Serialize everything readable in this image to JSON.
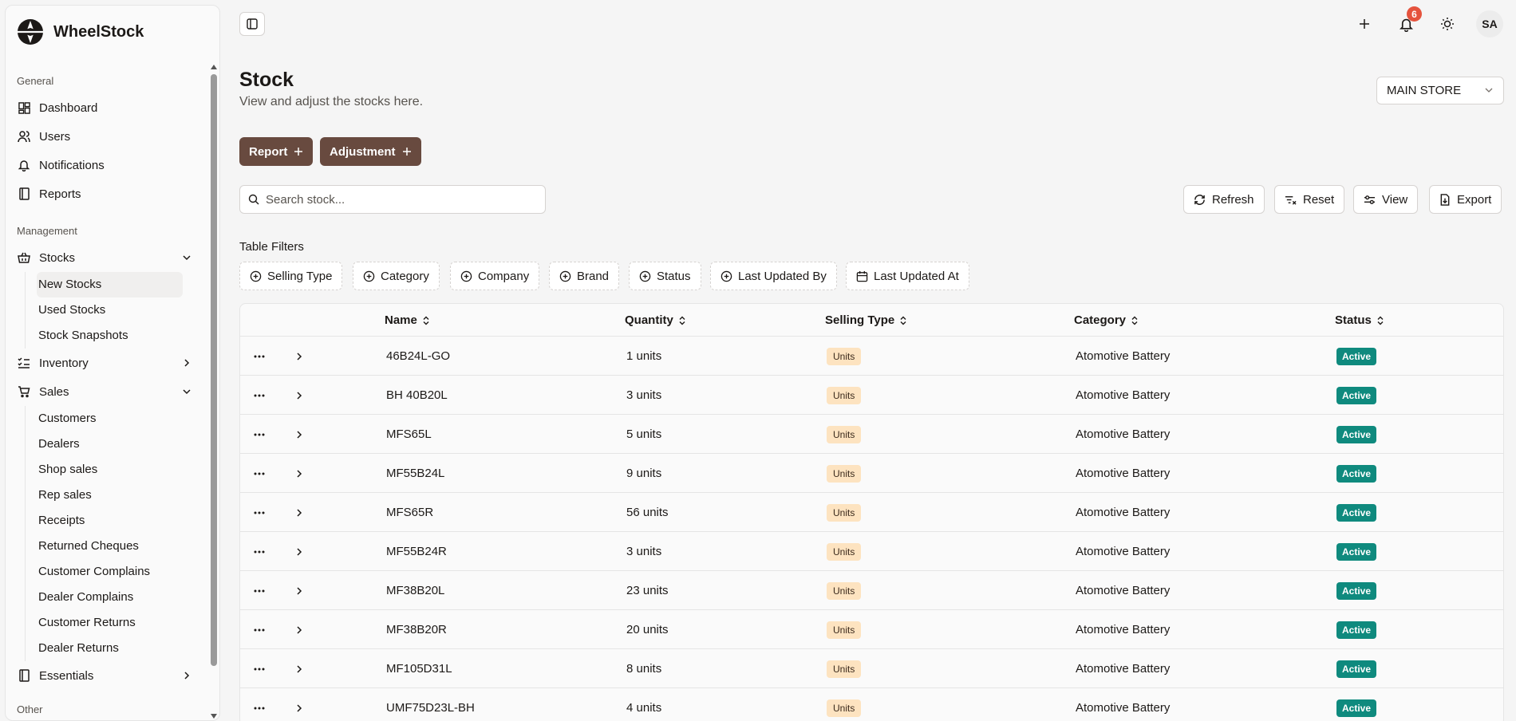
{
  "app": {
    "name": "WheelStock"
  },
  "sidebar": {
    "sections": [
      {
        "label": "General"
      },
      {
        "label": "Management"
      },
      {
        "label": "Other"
      }
    ],
    "general": [
      {
        "label": "Dashboard",
        "icon": "dashboard-icon"
      },
      {
        "label": "Users",
        "icon": "users-icon"
      },
      {
        "label": "Notifications",
        "icon": "bell-icon"
      },
      {
        "label": "Reports",
        "icon": "book-icon"
      }
    ],
    "stocks": {
      "label": "Stocks",
      "expanded": true,
      "children": [
        "New Stocks",
        "Used Stocks",
        "Stock Snapshots"
      ],
      "active_child": "New Stocks"
    },
    "inventory": {
      "label": "Inventory",
      "expanded": false
    },
    "sales": {
      "label": "Sales",
      "expanded": true,
      "children": [
        "Customers",
        "Dealers",
        "Shop sales",
        "Rep sales",
        "Receipts",
        "Returned Cheques",
        "Customer Complains",
        "Dealer Complains",
        "Customer Returns",
        "Dealer Returns"
      ]
    },
    "essentials": {
      "label": "Essentials",
      "expanded": false
    }
  },
  "topbar": {
    "notification_count": "6",
    "avatar": "SA"
  },
  "page": {
    "title": "Stock",
    "subtitle": "View and adjust the stocks here.",
    "store": "MAIN STORE"
  },
  "actions": {
    "report": "Report",
    "adjustment": "Adjustment"
  },
  "search": {
    "placeholder": "Search stock..."
  },
  "toolbar": {
    "refresh": "Refresh",
    "reset": "Reset",
    "view": "View",
    "export": "Export"
  },
  "filters": {
    "label": "Table Filters",
    "chips": [
      "Selling Type",
      "Category",
      "Company",
      "Brand",
      "Status",
      "Last Updated By",
      "Last Updated At"
    ]
  },
  "table": {
    "columns": [
      "Name",
      "Quantity",
      "Selling Type",
      "Category",
      "Status"
    ],
    "rows": [
      {
        "name": "46B24L-GO",
        "quantity": "1 units",
        "selling_type": "Units",
        "category": "Atomotive Battery",
        "status": "Active"
      },
      {
        "name": "BH 40B20L",
        "quantity": "3 units",
        "selling_type": "Units",
        "category": "Atomotive Battery",
        "status": "Active"
      },
      {
        "name": "MFS65L",
        "quantity": "5 units",
        "selling_type": "Units",
        "category": "Atomotive Battery",
        "status": "Active"
      },
      {
        "name": "MF55B24L",
        "quantity": "9 units",
        "selling_type": "Units",
        "category": "Atomotive Battery",
        "status": "Active"
      },
      {
        "name": "MFS65R",
        "quantity": "56 units",
        "selling_type": "Units",
        "category": "Atomotive Battery",
        "status": "Active"
      },
      {
        "name": "MF55B24R",
        "quantity": "3 units",
        "selling_type": "Units",
        "category": "Atomotive Battery",
        "status": "Active"
      },
      {
        "name": "MF38B20L",
        "quantity": "23 units",
        "selling_type": "Units",
        "category": "Atomotive Battery",
        "status": "Active"
      },
      {
        "name": "MF38B20R",
        "quantity": "20 units",
        "selling_type": "Units",
        "category": "Atomotive Battery",
        "status": "Active"
      },
      {
        "name": "MF105D31L",
        "quantity": "8 units",
        "selling_type": "Units",
        "category": "Atomotive Battery",
        "status": "Active"
      },
      {
        "name": "UMF75D23L-BH",
        "quantity": "4 units",
        "selling_type": "Units",
        "category": "Atomotive Battery",
        "status": "Active"
      }
    ]
  },
  "colors": {
    "primary_button": "#684a3f",
    "active_badge": "#0f8a7e",
    "units_badge": "#fde3c0",
    "notification_badge": "#e5533d"
  }
}
